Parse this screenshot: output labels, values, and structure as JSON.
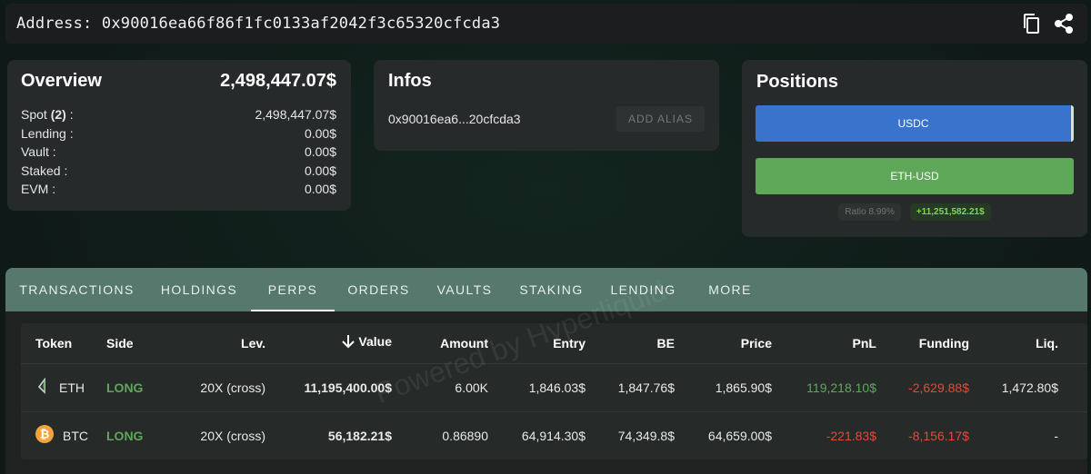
{
  "address_bar": {
    "label": "Address:",
    "address": "0x90016ea66f86f1fc0133af2042f3c65320cfcda3",
    "icons": [
      "copy-icon",
      "share-icon"
    ]
  },
  "overview": {
    "title": "Overview",
    "total": "2,498,447.07$",
    "rows": [
      {
        "label": "Spot",
        "count": "(2)",
        "suffix": " :",
        "value": "2,498,447.07$"
      },
      {
        "label": "Lending :",
        "value": "0.00$"
      },
      {
        "label": "Vault :",
        "value": "0.00$"
      },
      {
        "label": "Staked :",
        "value": "0.00$"
      },
      {
        "label": "EVM :",
        "value": "0.00$"
      }
    ]
  },
  "infos": {
    "title": "Infos",
    "short_address": "0x90016ea6...20cfcda3",
    "add_alias": "ADD ALIAS"
  },
  "positions": {
    "title": "Positions",
    "bars": [
      {
        "label": "USDC",
        "color": "#3a73cc"
      },
      {
        "label": "ETH-USD",
        "color": "#5fa85a"
      }
    ],
    "ratio_label": "Ratio",
    "ratio_value": "8.99%",
    "pnl": "+11,251,582.21$"
  },
  "tabs": [
    "TRANSACTIONS",
    "HOLDINGS",
    "PERPS",
    "ORDERS",
    "VAULTS",
    "STAKING",
    "LENDING",
    "MORE"
  ],
  "active_tab": "PERPS",
  "table": {
    "headers": [
      "Token",
      "Side",
      "Lev.",
      "Value",
      "Amount",
      "Entry",
      "BE",
      "Price",
      "PnL",
      "Funding",
      "Liq."
    ],
    "sort_icon": "arrow-down-icon",
    "rows": [
      {
        "token": "ETH",
        "icon": "eth-icon",
        "side": "LONG",
        "lev": "20X (cross)",
        "value": "11,195,400.00$",
        "amount": "6.00K",
        "entry": "1,846.03$",
        "be": "1,847.76$",
        "price": "1,865.90$",
        "pnl": "119,218.10$",
        "funding": "-2,629.88$",
        "liq": "1,472.80$"
      },
      {
        "token": "BTC",
        "icon": "btc-icon",
        "side": "LONG",
        "lev": "20X (cross)",
        "value": "56,182.21$",
        "amount": "0.86890",
        "entry": "64,914.30$",
        "be": "74,349.8$",
        "price": "64,659.00$",
        "pnl": "-221.83$",
        "funding": "-8,156.17$",
        "liq": "-"
      }
    ]
  },
  "watermark": "Powered by Hyperliquid",
  "colors": {
    "accent": "#56786d",
    "long": "#5fa85a",
    "negative": "#e04a3a",
    "usdc": "#3a73cc"
  }
}
